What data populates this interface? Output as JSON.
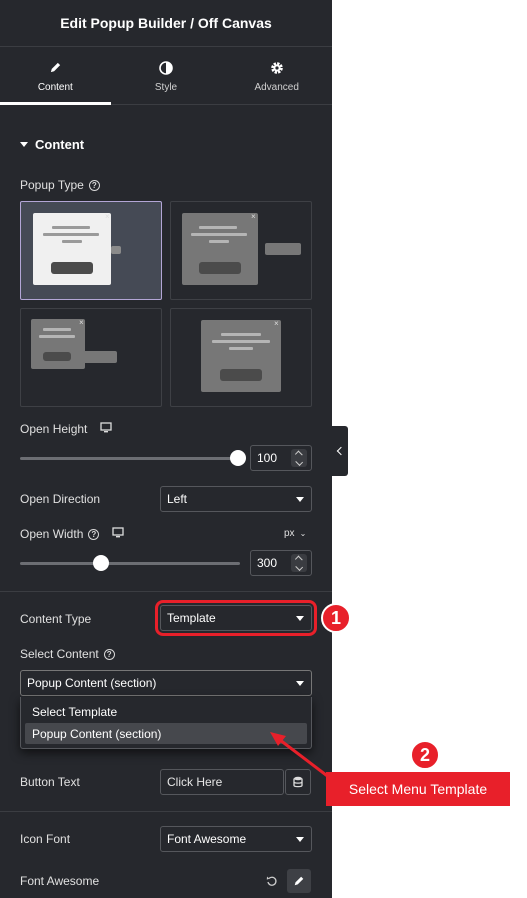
{
  "panel": {
    "title": "Edit Popup Builder / Off Canvas",
    "tabs": [
      {
        "label": "Content",
        "icon": "pencil-icon",
        "active": true
      },
      {
        "label": "Style",
        "icon": "half-circle-icon",
        "active": false
      },
      {
        "label": "Advanced",
        "icon": "gear-icon",
        "active": false
      }
    ],
    "section_title": "Content"
  },
  "popup_type": {
    "label": "Popup Type",
    "selected_index": 0
  },
  "open_height": {
    "label": "Open Height",
    "value": "100",
    "slider_fraction": 1.0
  },
  "open_direction": {
    "label": "Open Direction",
    "value": "Left"
  },
  "open_width": {
    "label": "Open Width",
    "unit": "px",
    "value": "300",
    "slider_fraction": 0.37
  },
  "content_type": {
    "label": "Content Type",
    "value": "Template"
  },
  "select_content": {
    "label": "Select Content",
    "value": "Popup Content (section)",
    "options": [
      "Select Template",
      "Popup Content (section)"
    ]
  },
  "button_text": {
    "label": "Button Text",
    "value": "Click Here"
  },
  "icon_font": {
    "label": "Icon Font",
    "value": "Font Awesome"
  },
  "font_awesome": {
    "label": "Font Awesome"
  },
  "annotations": {
    "marker1": "1",
    "marker2": "2",
    "callout": "Select Menu Template"
  },
  "colors": {
    "panel_bg": "#26282d",
    "accent_red": "#e8202a",
    "selected_border": "#b3a6d6"
  }
}
